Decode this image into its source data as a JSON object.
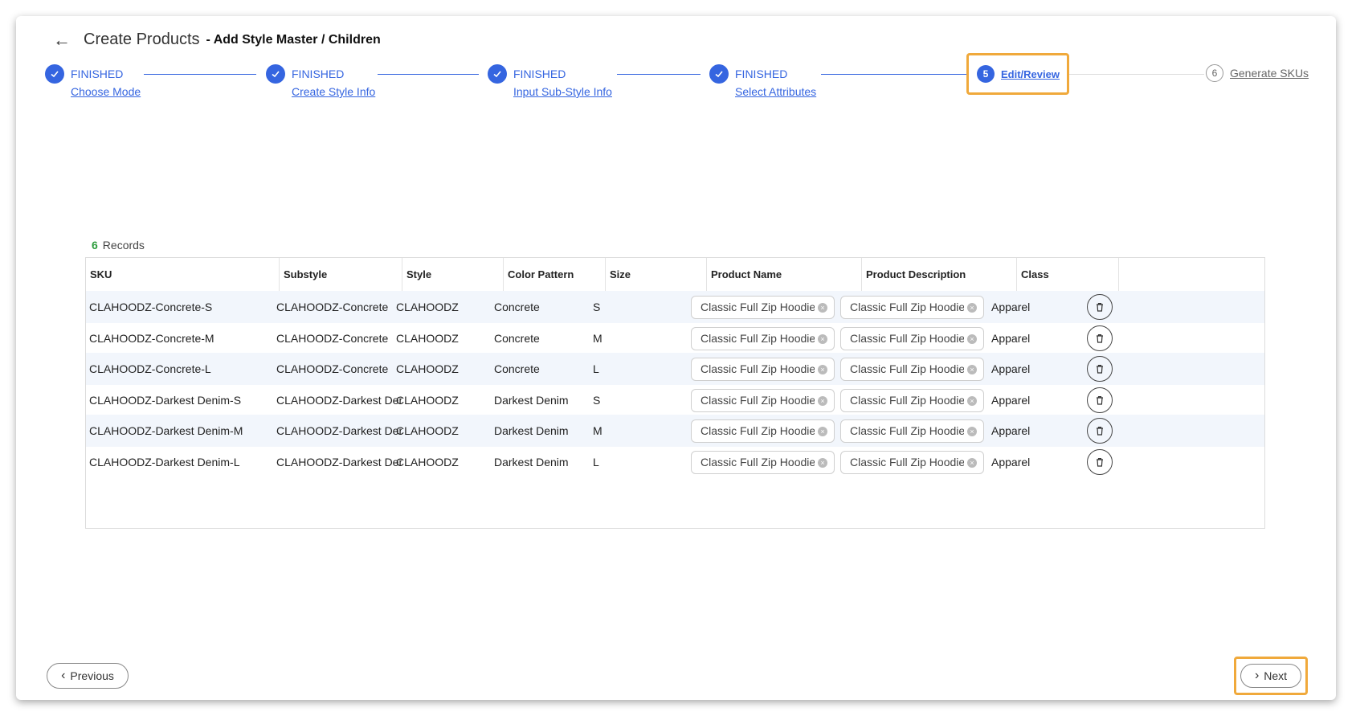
{
  "header": {
    "title": "Create Products",
    "subtitle": "- Add Style Master / Children"
  },
  "steps": [
    {
      "status": "FINISHED",
      "label": "Choose Mode"
    },
    {
      "status": "FINISHED",
      "label": "Create Style Info"
    },
    {
      "status": "FINISHED",
      "label": "Input Sub-Style Info"
    },
    {
      "status": "FINISHED",
      "label": "Select Attributes"
    },
    {
      "number": "5",
      "label": "Edit/Review"
    },
    {
      "number": "6",
      "label": "Generate SKUs"
    }
  ],
  "records": {
    "count": "6",
    "label": "Records"
  },
  "table": {
    "columns": [
      "SKU",
      "Substyle",
      "Style",
      "Color Pattern",
      "Size",
      "Product Name",
      "Product Description",
      "Class"
    ],
    "rows": [
      {
        "sku": "CLAHOODZ-Concrete-S",
        "substyle": "CLAHOODZ-Concrete",
        "style": "CLAHOODZ",
        "color": "Concrete",
        "size": "S",
        "name": "Classic Full Zip Hoodie S",
        "desc": "Classic Full Zip Hoodie w",
        "cls": "Apparel"
      },
      {
        "sku": "CLAHOODZ-Concrete-M",
        "substyle": "CLAHOODZ-Concrete",
        "style": "CLAHOODZ",
        "color": "Concrete",
        "size": "M",
        "name": "Classic Full Zip Hoodie S",
        "desc": "Classic Full Zip Hoodie w",
        "cls": "Apparel"
      },
      {
        "sku": "CLAHOODZ-Concrete-L",
        "substyle": "CLAHOODZ-Concrete",
        "style": "CLAHOODZ",
        "color": "Concrete",
        "size": "L",
        "name": "Classic Full Zip Hoodie S",
        "desc": "Classic Full Zip Hoodie w",
        "cls": "Apparel"
      },
      {
        "sku": "CLAHOODZ-Darkest Denim-S",
        "substyle": "CLAHOODZ-Darkest Der",
        "style": "CLAHOODZ",
        "color": "Darkest Denim",
        "size": "S",
        "name": "Classic Full Zip Hoodie S",
        "desc": "Classic Full Zip Hoodie w",
        "cls": "Apparel"
      },
      {
        "sku": "CLAHOODZ-Darkest Denim-M",
        "substyle": "CLAHOODZ-Darkest Der",
        "style": "CLAHOODZ",
        "color": "Darkest Denim",
        "size": "M",
        "name": "Classic Full Zip Hoodie S",
        "desc": "Classic Full Zip Hoodie w",
        "cls": "Apparel"
      },
      {
        "sku": "CLAHOODZ-Darkest Denim-L",
        "substyle": "CLAHOODZ-Darkest Der",
        "style": "CLAHOODZ",
        "color": "Darkest Denim",
        "size": "L",
        "name": "Classic Full Zip Hoodie S",
        "desc": "Classic Full Zip Hoodie w",
        "cls": "Apparel"
      }
    ]
  },
  "footer": {
    "previous_label": "Previous",
    "next_label": "Next"
  },
  "colors": {
    "accent": "#3565e0",
    "highlight": "#f0a93b",
    "records_count": "#2e9d3e"
  }
}
